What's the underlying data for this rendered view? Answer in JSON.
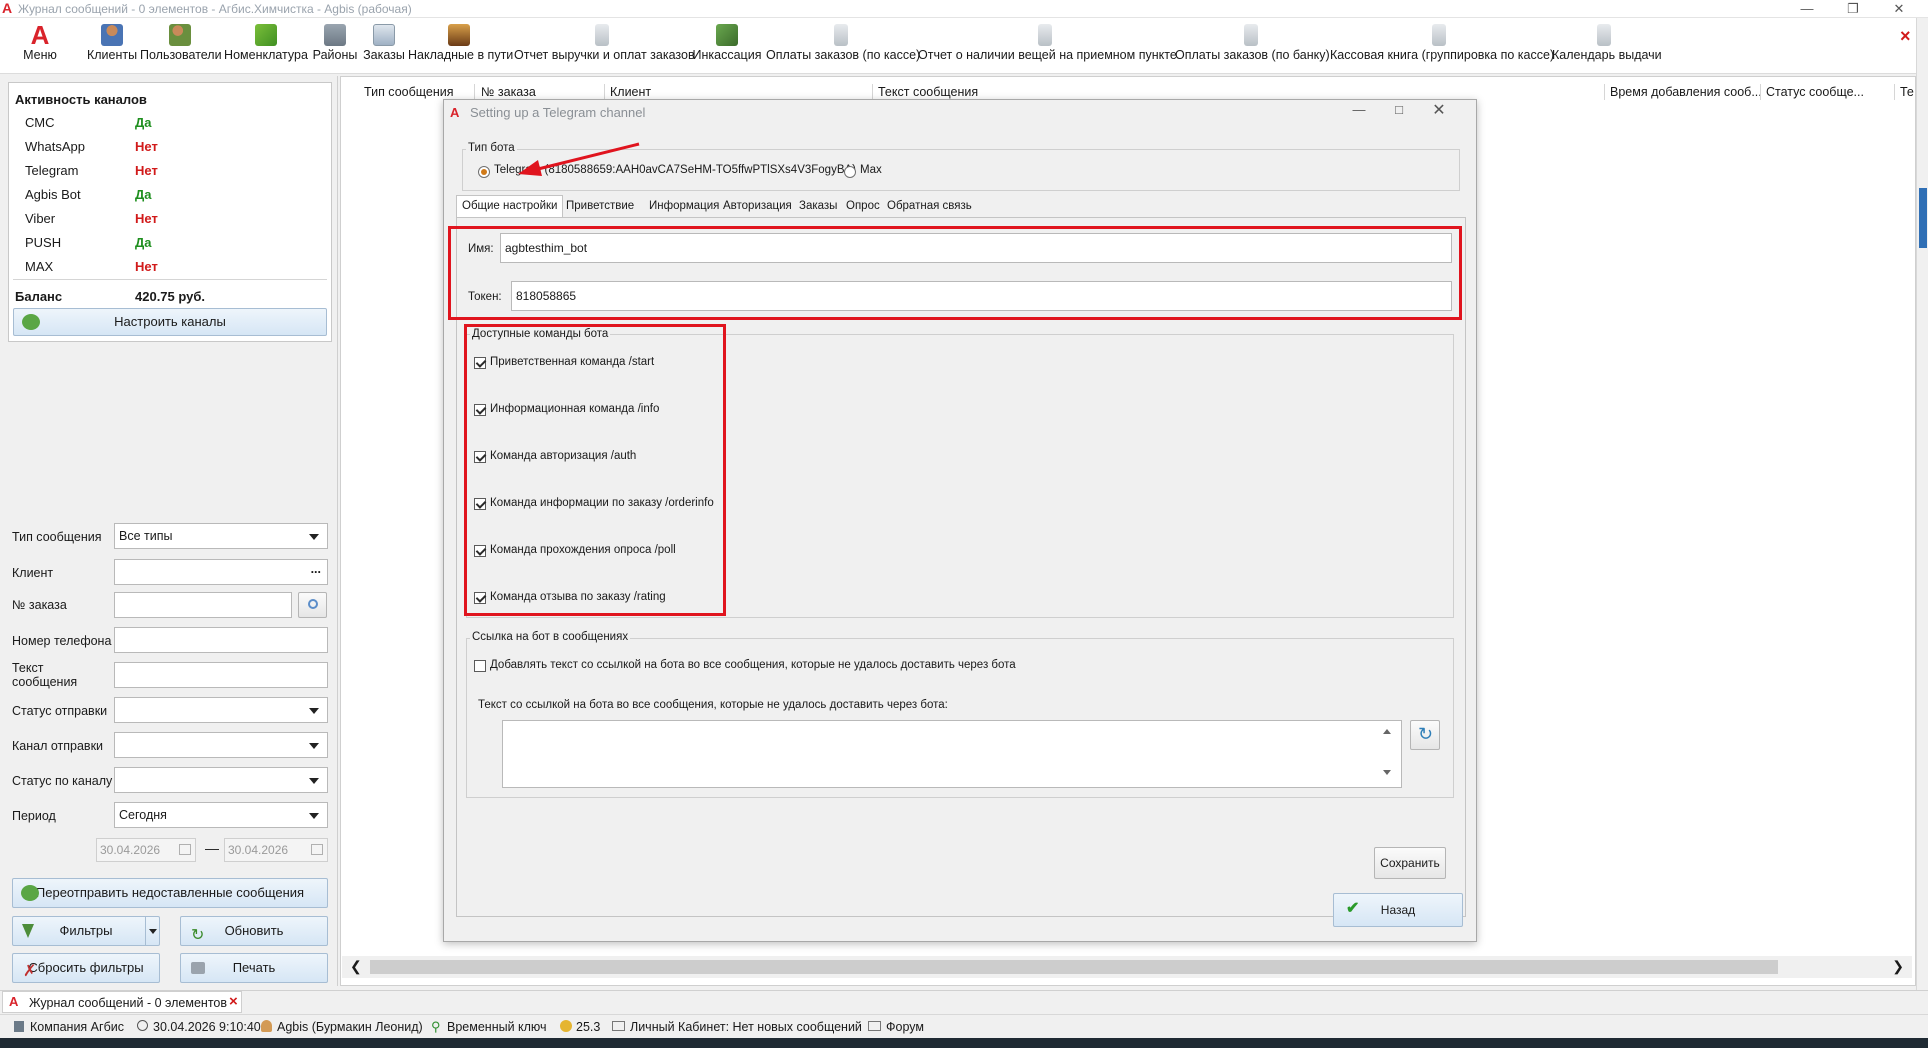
{
  "window": {
    "title": "Журнал сообщений - 0 элементов - Агбис.Химчистка - Agbis (рабочая)",
    "app_icon": "A"
  },
  "toolbar": {
    "items": [
      {
        "label": "Меню",
        "icon": "menu-logo-icon"
      },
      {
        "label": "Клиенты",
        "icon": "clients-icon"
      },
      {
        "label": "Пользователи",
        "icon": "users-icon"
      },
      {
        "label": "Номенклатура",
        "icon": "nomenclature-icon"
      },
      {
        "label": "Районы",
        "icon": "districts-icon"
      },
      {
        "label": "Заказы",
        "icon": "orders-icon"
      },
      {
        "label": "Накладные в пути",
        "icon": "waybills-icon"
      },
      {
        "label": "Отчет выручки и оплат заказов",
        "icon": "report-icon"
      },
      {
        "label": "Инкассация",
        "icon": "collection-icon"
      },
      {
        "label": "Оплаты заказов (по кассе)",
        "icon": "report-icon"
      },
      {
        "label": "Отчет о наличии вещей на приемном пункте",
        "icon": "report-icon"
      },
      {
        "label": "Оплаты заказов (по банку)",
        "icon": "report-icon"
      },
      {
        "label": "Кассовая книга (группировка по кассе)",
        "icon": "report-icon"
      },
      {
        "label": "Календарь выдачи",
        "icon": "report-icon"
      }
    ],
    "close_glyph": "×"
  },
  "channels": {
    "heading": "Активность каналов",
    "rows": [
      {
        "name": "СМС",
        "value": "Да",
        "status": "yes"
      },
      {
        "name": "WhatsApp",
        "value": "Нет",
        "status": "no"
      },
      {
        "name": "Telegram",
        "value": "Нет",
        "status": "no"
      },
      {
        "name": "Agbis Bot",
        "value": "Да",
        "status": "yes"
      },
      {
        "name": "Viber",
        "value": "Нет",
        "status": "no"
      },
      {
        "name": "PUSH",
        "value": "Да",
        "status": "yes"
      },
      {
        "name": "MAX",
        "value": "Нет",
        "status": "no"
      }
    ],
    "balance_label": "Баланс",
    "balance_value": "420.75 руб.",
    "configure_button": "Настроить каналы"
  },
  "filters": {
    "type_label": "Тип сообщения",
    "type_value": "Все типы",
    "client_label": "Клиент",
    "client_more": "...",
    "order_label": "№ заказа",
    "phone_label": "Номер телефона",
    "text_label_1": "Текст",
    "text_label_2": "сообщения",
    "send_status_label": "Статус отправки",
    "send_channel_label": "Канал отправки",
    "channel_status_label": "Статус по каналу",
    "period_label": "Период",
    "period_value": "Сегодня",
    "date_from": "30.04.2026",
    "date_sep": "—",
    "date_to": "30.04.2026",
    "resend_button": "Переотправить недоставленные сообщения",
    "filters_button": "Фильтры",
    "refresh_button": "Обновить",
    "reset_button": "Сбросить фильтры",
    "print_button": "Печать"
  },
  "grid": {
    "columns": [
      "Тип сообщения",
      "№ заказа",
      "Клиент",
      "Текст сообщения",
      "Время добавления сооб...",
      "Статус сообще...",
      "Те"
    ]
  },
  "dialog": {
    "title": "Setting up a Telegram channel",
    "bot_type_group": "Тип бота",
    "radio_telegram": "Telegram (8180588659:AAH0avCA7SeHM-TO5ffwPTlSXs4V3FogyBA)",
    "radio_max": "Max",
    "tabs": [
      "Общие настройки",
      "Приветствие",
      "Информация",
      "Авторизация",
      "Заказы",
      "Опрос",
      "Обратная связь"
    ],
    "name_label": "Имя:",
    "name_value": "agbtesthim_bot",
    "token_label": "Токен:",
    "token_value": "818058865",
    "commands_group": "Доступные команды бота",
    "commands": [
      "Приветственная команда /start",
      "Информационная команда /info",
      "Команда авторизация /auth",
      "Команда информации по заказу /orderinfo",
      "Команда прохождения опроса /poll",
      "Команда отзыва по заказу /rating"
    ],
    "link_group": "Ссылка на бот в сообщениях",
    "link_checkbox": "Добавлять текст со ссылкой на бота во все сообщения, которые не удалось доставить через бота",
    "link_text_label": "Текст со ссылкой на бота во все сообщения, которые не удалось доставить через бота:",
    "save_button": "Сохранить",
    "back_button": "Назад"
  },
  "docbar": {
    "tab_label": "Журнал сообщений - 0 элементов",
    "close_glyph": "×"
  },
  "statusbar": {
    "company": "Компания Агбис",
    "datetime": "30.04.2026 9:10:40",
    "user": "Agbis (Бурмакин Леонид)",
    "key": "Временный ключ",
    "coins": "25.3",
    "cabinet": "Личный Кабинет: Нет новых сообщений",
    "forum": "Форум"
  },
  "colors": {
    "accent_red": "#e0141e",
    "yes_green": "#1e8f1e",
    "no_red": "#d11a1a",
    "radio_orange": "#d07a19"
  }
}
